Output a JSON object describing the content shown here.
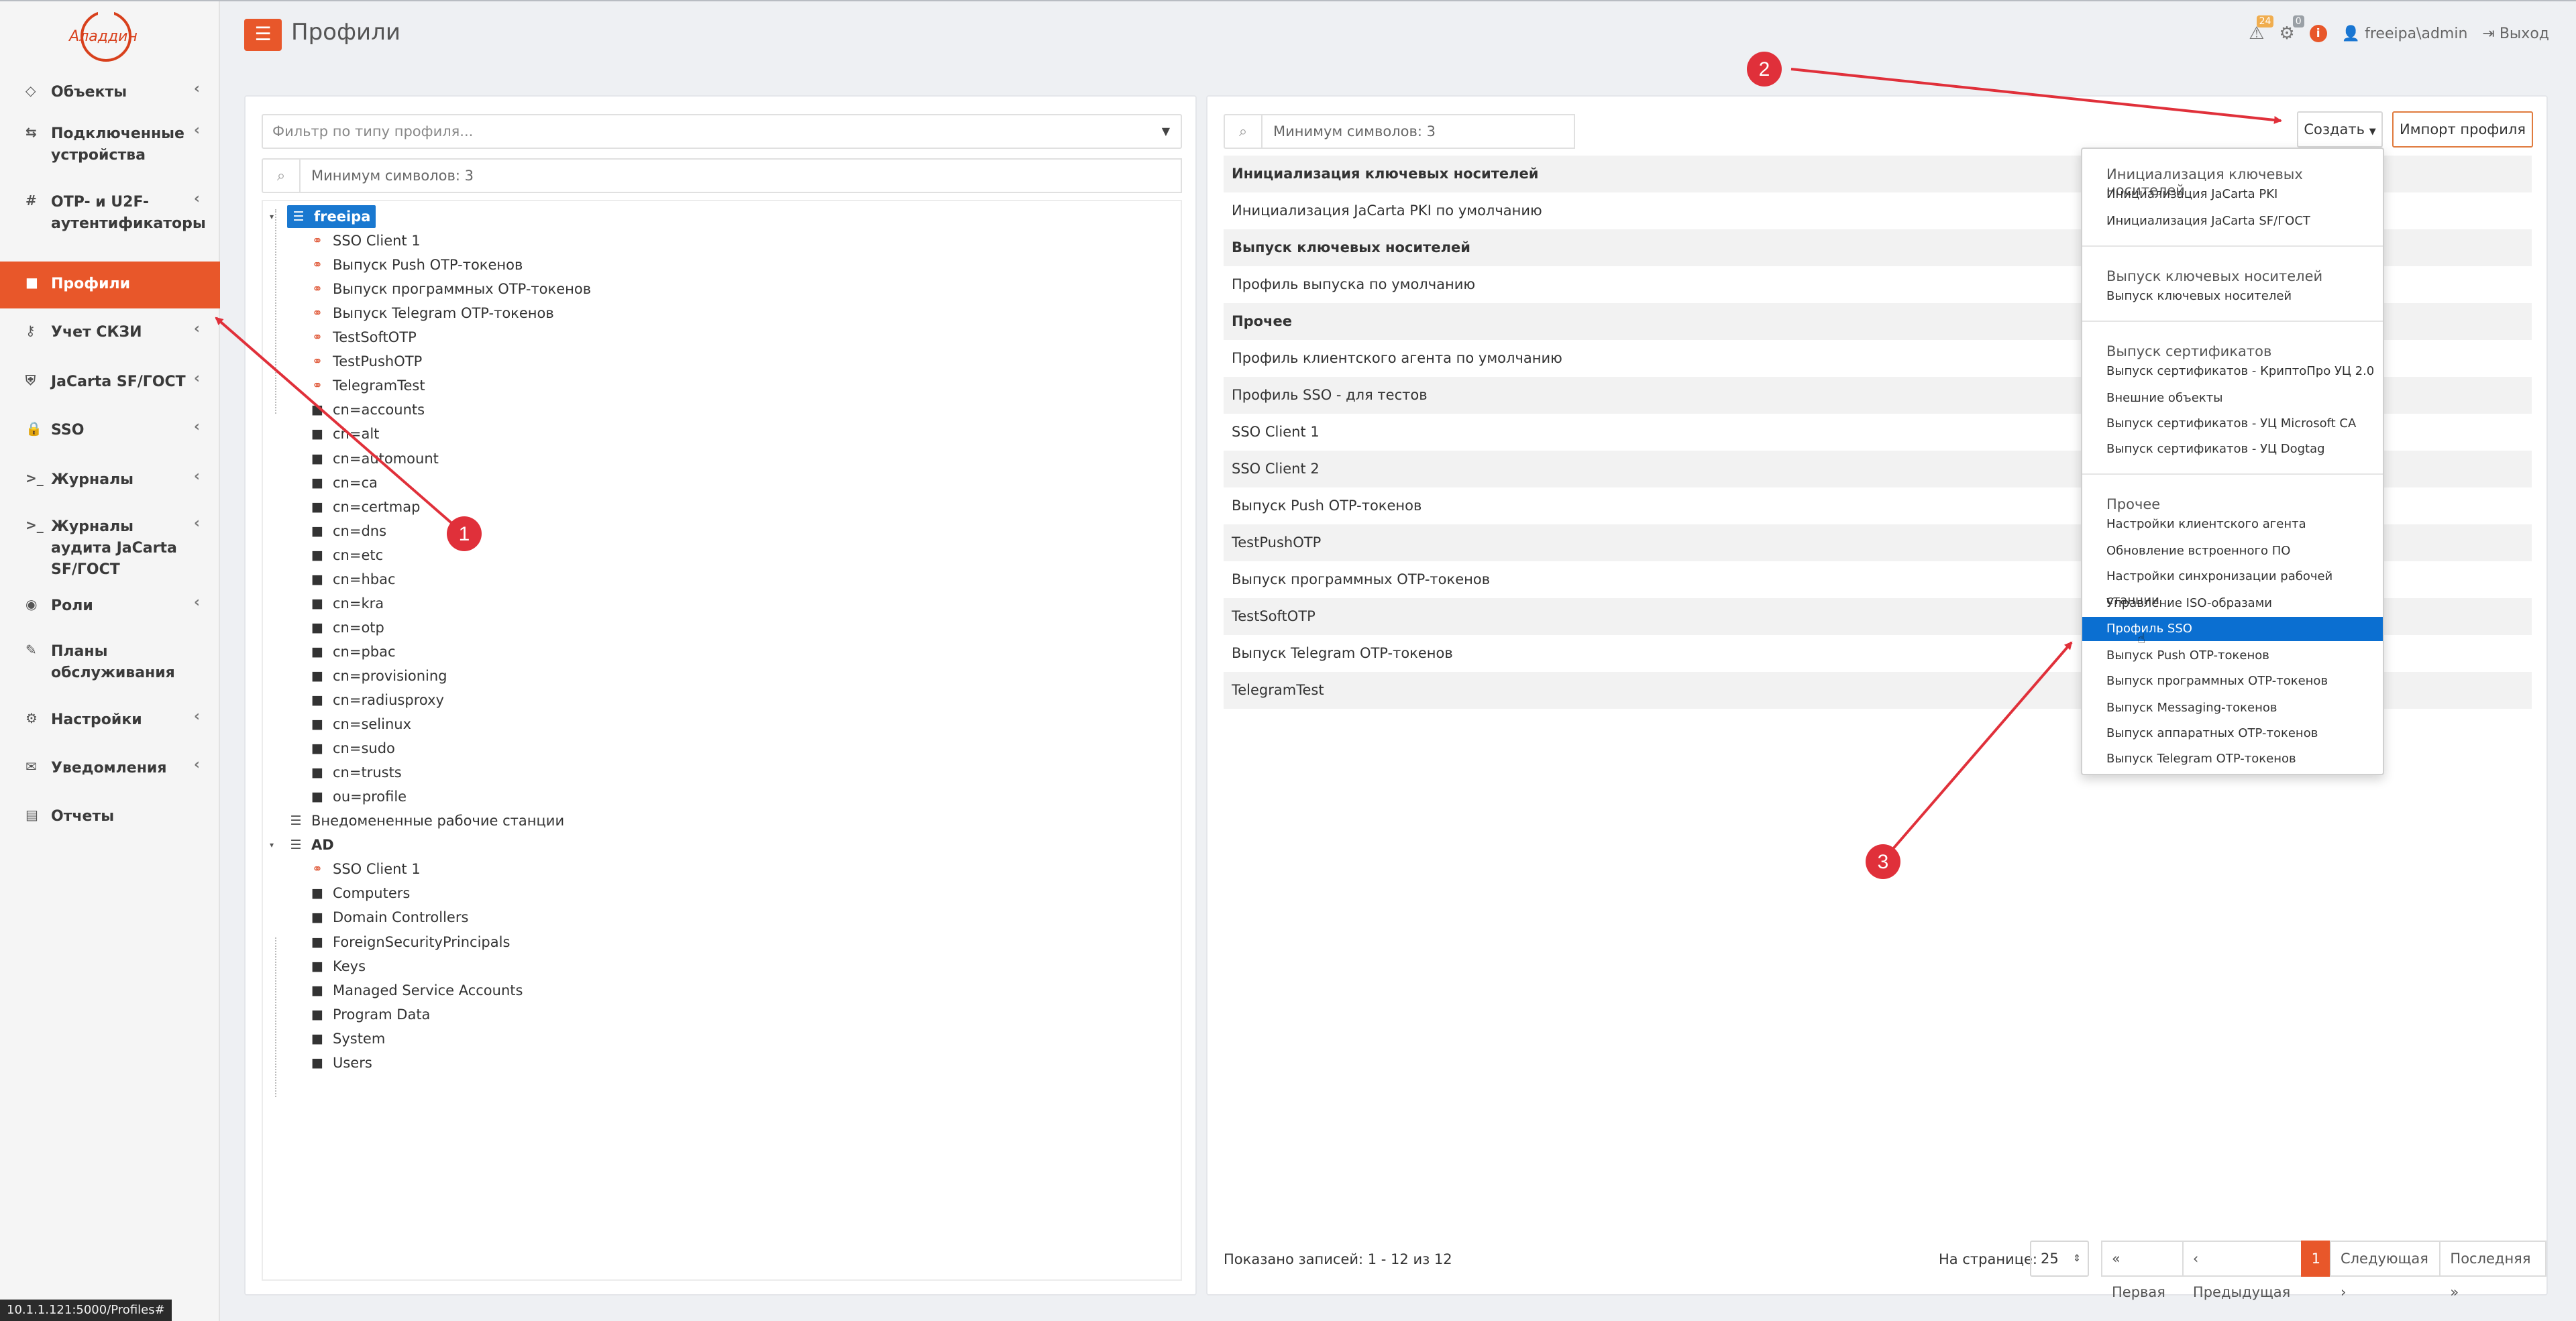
{
  "app": {
    "logo_text": "Аладдин",
    "page_title": "Профили"
  },
  "header": {
    "alerts_count": "24",
    "tasks_count": "0",
    "user": "freeipa\\admin",
    "logout": "Выход"
  },
  "sidebar": {
    "items": [
      {
        "label": "Объекты",
        "icon": "gem-icon",
        "chevron": true
      },
      {
        "label": "Подключенные устройства",
        "icon": "devices-icon",
        "chevron": true
      },
      {
        "label": "OTP- и U2F-аутентификаторы",
        "icon": "hash-icon",
        "chevron": true
      },
      {
        "label": "Профили",
        "icon": "folder-icon",
        "chevron": false,
        "active": true
      },
      {
        "label": "Учет СКЗИ",
        "icon": "key-icon",
        "chevron": true
      },
      {
        "label": "JaCarta SF/ГОСТ",
        "icon": "shield-icon",
        "chevron": true
      },
      {
        "label": "SSO",
        "icon": "lock-icon",
        "chevron": true
      },
      {
        "label": "Журналы",
        "icon": "terminal-icon",
        "chevron": true
      },
      {
        "label": "Журналы аудита JaCarta SF/ГОСТ",
        "icon": "terminal-icon",
        "chevron": true
      },
      {
        "label": "Роли",
        "icon": "user-circle-icon",
        "chevron": true
      },
      {
        "label": "Планы обслуживания",
        "icon": "wrench-icon",
        "chevron": false
      },
      {
        "label": "Настройки",
        "icon": "gears-icon",
        "chevron": true
      },
      {
        "label": "Уведомления",
        "icon": "envelope-icon",
        "chevron": true
      },
      {
        "label": "Отчеты",
        "icon": "document-icon",
        "chevron": false
      }
    ]
  },
  "left": {
    "filter_placeholder": "Фильтр по типу профиля...",
    "search_placeholder": "Минимум символов: 3",
    "tree": [
      {
        "label": "freeipa",
        "type": "grid",
        "level": 0,
        "selected": true
      },
      {
        "label": "SSO Client 1",
        "type": "link",
        "level": 1
      },
      {
        "label": "Выпуск Push OTP-токенов",
        "type": "link",
        "level": 1
      },
      {
        "label": "Выпуск программных OTP-токенов",
        "type": "link",
        "level": 1
      },
      {
        "label": "Выпуск Telegram OTP-токенов",
        "type": "link",
        "level": 1
      },
      {
        "label": "TestSoftOTP",
        "type": "link",
        "level": 1
      },
      {
        "label": "TestPushOTP",
        "type": "link",
        "level": 1
      },
      {
        "label": "TelegramTest",
        "type": "link",
        "level": 1
      },
      {
        "label": "cn=accounts",
        "type": "folder",
        "level": 1
      },
      {
        "label": "cn=alt",
        "type": "folder",
        "level": 1
      },
      {
        "label": "cn=automount",
        "type": "folder",
        "level": 1
      },
      {
        "label": "cn=ca",
        "type": "folder",
        "level": 1
      },
      {
        "label": "cn=certmap",
        "type": "folder",
        "level": 1
      },
      {
        "label": "cn=dns",
        "type": "folder",
        "level": 1
      },
      {
        "label": "cn=etc",
        "type": "folder",
        "level": 1
      },
      {
        "label": "cn=hbac",
        "type": "folder",
        "level": 1
      },
      {
        "label": "cn=kra",
        "type": "folder",
        "level": 1
      },
      {
        "label": "cn=otp",
        "type": "folder",
        "level": 1
      },
      {
        "label": "cn=pbac",
        "type": "folder",
        "level": 1
      },
      {
        "label": "cn=provisioning",
        "type": "folder",
        "level": 1
      },
      {
        "label": "cn=radiusproxy",
        "type": "folder",
        "level": 1
      },
      {
        "label": "cn=selinux",
        "type": "folder",
        "level": 1
      },
      {
        "label": "cn=sudo",
        "type": "folder",
        "level": 1
      },
      {
        "label": "cn=trusts",
        "type": "folder",
        "level": 1
      },
      {
        "label": "ou=profile",
        "type": "folder",
        "level": 1
      },
      {
        "label": "Внедомененные рабочие станции",
        "type": "grid",
        "level": 0
      },
      {
        "label": "AD",
        "type": "grid",
        "level": 0,
        "bold": true
      },
      {
        "label": "SSO Client 1",
        "type": "link",
        "level": 1
      },
      {
        "label": "Computers",
        "type": "folder",
        "level": 1
      },
      {
        "label": "Domain Controllers",
        "type": "folder",
        "level": 1
      },
      {
        "label": "ForeignSecurityPrincipals",
        "type": "folder",
        "level": 1
      },
      {
        "label": "Keys",
        "type": "folder",
        "level": 1
      },
      {
        "label": "Managed Service Accounts",
        "type": "folder",
        "level": 1
      },
      {
        "label": "Program Data",
        "type": "folder",
        "level": 1
      },
      {
        "label": "System",
        "type": "folder",
        "level": 1
      },
      {
        "label": "Users",
        "type": "folder",
        "level": 1
      }
    ]
  },
  "right": {
    "search_placeholder": "Минимум символов: 3",
    "create_label": "Создать",
    "import_label": "Импорт профиля",
    "rows": [
      {
        "label": "Инициализация ключевых носителей",
        "group": true
      },
      {
        "label": "Инициализация JaCarta PKI по умолчанию"
      },
      {
        "label": "Выпуск ключевых носителей",
        "group": true
      },
      {
        "label": "Профиль выпуска по умолчанию"
      },
      {
        "label": "Прочее",
        "group": true
      },
      {
        "label": "Профиль клиентского агента по умолчанию"
      },
      {
        "label": "Профиль SSO - для тестов"
      },
      {
        "label": "SSO Client 1"
      },
      {
        "label": "SSO Client 2"
      },
      {
        "label": "Выпуск Push OTP-токенов"
      },
      {
        "label": "TestPushOTP"
      },
      {
        "label": "Выпуск программных OTP-токенов"
      },
      {
        "label": "TestSoftOTP"
      },
      {
        "label": "Выпуск Telegram OTP-токенов"
      },
      {
        "label": "TelegramTest"
      }
    ],
    "records_text": "Показано записей: 1 - 12 из 12",
    "per_page_label": "На странице:",
    "per_page_value": "25",
    "pager": {
      "first": "« Первая",
      "prev": "‹ Предыдущая",
      "current": "1",
      "next": "Следующая ›",
      "last": "Последняя »"
    }
  },
  "dropdown": {
    "sections": [
      {
        "header": "Инициализация ключевых носителей",
        "items": [
          "Инициализация JaCarta PKI",
          "Инициализация JaCarta SF/ГОСТ"
        ]
      },
      {
        "header": "Выпуск ключевых носителей",
        "items": [
          "Выпуск ключевых носителей"
        ]
      },
      {
        "header": "Выпуск сертификатов",
        "items": [
          "Выпуск сертификатов - КриптоПро УЦ 2.0",
          "Внешние объекты",
          "Выпуск сертификатов - УЦ Microsoft CA",
          "Выпуск сертификатов - УЦ Dogtag"
        ]
      },
      {
        "header": "Прочее",
        "items": [
          "Настройки клиентского агента",
          "Обновление встроенного ПО",
          "Настройки синхронизации рабочей станции",
          "Управление ISO-образами",
          "Профиль SSO",
          "Выпуск Push OTP-токенов",
          "Выпуск программных OTP-токенов",
          "Выпуск Messaging-токенов",
          "Выпуск аппаратных OTP-токенов",
          "Выпуск Telegram OTP-токенов"
        ]
      }
    ],
    "highlighted": "Профиль SSO"
  },
  "annotations": [
    {
      "label": "1"
    },
    {
      "label": "2"
    },
    {
      "label": "3"
    }
  ],
  "status_bar": {
    "url": "10.1.1.121:5000/Profiles#"
  },
  "colors": {
    "accent": "#e8572a",
    "selection": "#1978d0",
    "annotation": "#e0303a"
  }
}
